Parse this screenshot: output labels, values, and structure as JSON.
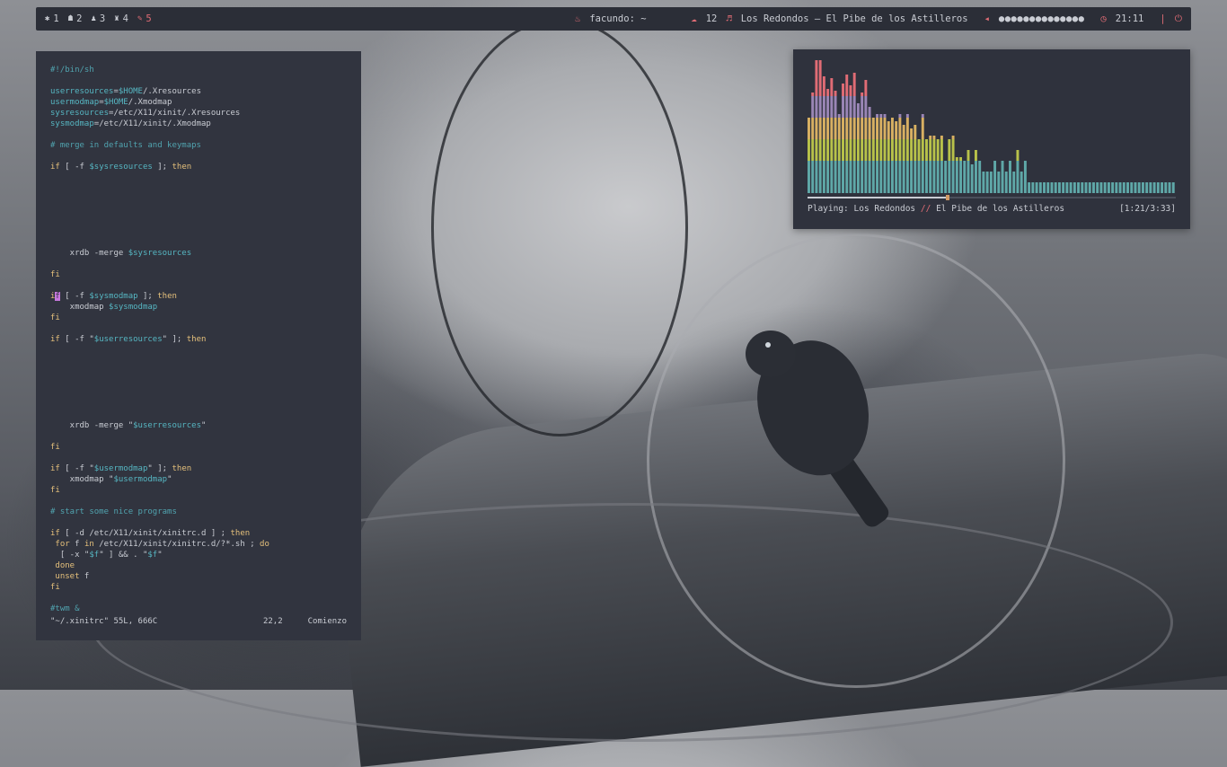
{
  "topbar": {
    "workspaces": [
      {
        "icon": "✱",
        "label": "1"
      },
      {
        "icon": "☗",
        "label": "2"
      },
      {
        "icon": "♟",
        "label": "3"
      },
      {
        "icon": "♜",
        "label": "4"
      },
      {
        "icon": "✎",
        "label": "5"
      }
    ],
    "window_title": "facundo: ~",
    "updates_count": "12",
    "now_playing": "Los Redondos – El Pibe de los Astilleros",
    "volume_dots": "●●●●●●●●●●●●●●",
    "clock": "21:11",
    "separator": "|",
    "icons": {
      "title": "flame-icon",
      "updates": "package-icon",
      "music": "music-note-icon",
      "volume": "speaker-icon",
      "clock": "clock-icon",
      "power": "power-icon"
    },
    "accent": "#e06c75"
  },
  "terminal": {
    "status_file": "\"~/.xinitrc\" 55L, 666C",
    "status_pos": "22,2",
    "status_scroll": "Comienzo"
  },
  "visualizer": {
    "playing_label": "Playing:",
    "artist": "Los Redondos",
    "sep": "//",
    "track": "El Pibe de los Astilleros",
    "time": "[1:21/3:33]",
    "progress": 0.38,
    "colors": [
      "#5fa8a8",
      "#b8c24a",
      "#d8b062",
      "#9a86b6",
      "#e06c75"
    ],
    "bars": [
      84,
      112,
      148,
      156,
      130,
      116,
      128,
      114,
      88,
      122,
      132,
      120,
      134,
      100,
      112,
      126,
      96,
      84,
      88,
      88,
      88,
      80,
      84,
      80,
      88,
      76,
      88,
      72,
      76,
      60,
      88,
      60,
      64,
      64,
      60,
      64,
      36,
      60,
      64,
      40,
      40,
      36,
      48,
      32,
      48,
      36,
      24,
      24,
      24,
      36,
      24,
      36,
      24,
      36,
      24,
      48,
      24,
      36,
      12,
      12,
      12,
      12,
      12,
      12,
      12,
      12,
      12,
      12,
      12,
      12,
      12,
      12,
      12,
      12,
      12,
      12,
      12,
      12,
      12,
      12,
      12,
      12,
      12,
      12,
      12,
      12,
      12,
      12,
      12,
      12,
      12,
      12,
      12,
      12,
      12,
      12,
      12
    ]
  }
}
